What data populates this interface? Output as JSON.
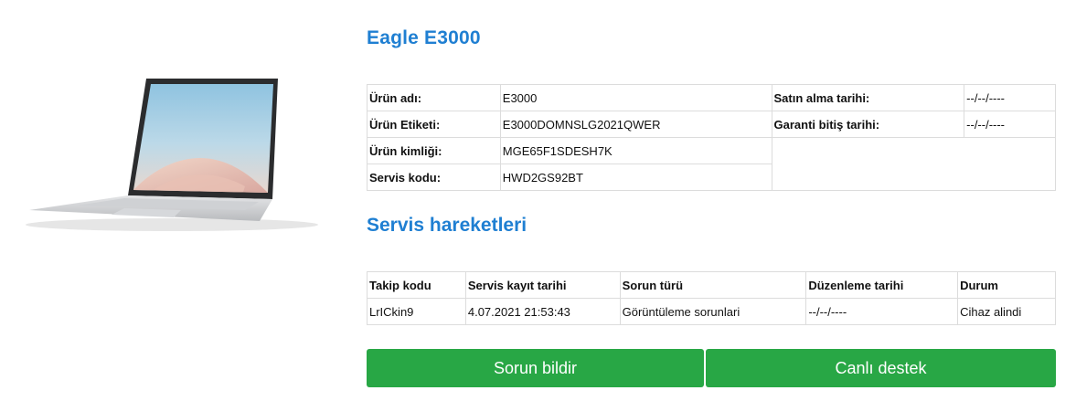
{
  "product": {
    "title": "Eagle E3000",
    "info": {
      "name_label": "Ürün adı:",
      "name_value": "E3000",
      "tag_label": "Ürün Etiketi:",
      "tag_value": "E3000DOMNSLG2021QWER",
      "id_label": "Ürün kimliği:",
      "id_value": "MGE65F1SDESH7K",
      "service_code_label": "Servis kodu:",
      "service_code_value": "HWD2GS92BT",
      "purchase_date_label": "Satın alma tarihi:",
      "purchase_date_value": "--/--/----",
      "warranty_end_label": "Garanti bitiş tarihi:",
      "warranty_end_value": "--/--/----"
    }
  },
  "service": {
    "title": "Servis hareketleri",
    "columns": [
      "Takip kodu",
      "Servis kayıt tarihi",
      "Sorun türü",
      "Düzenleme tarihi",
      "Durum"
    ],
    "rows": [
      [
        "LrICkin9",
        "4.07.2021 21:53:43",
        "Görüntüleme sorunlari",
        "--/--/----",
        "Cihaz alindi"
      ]
    ]
  },
  "actions": {
    "report_label": "Sorun bildir",
    "live_support_label": "Canlı destek"
  }
}
